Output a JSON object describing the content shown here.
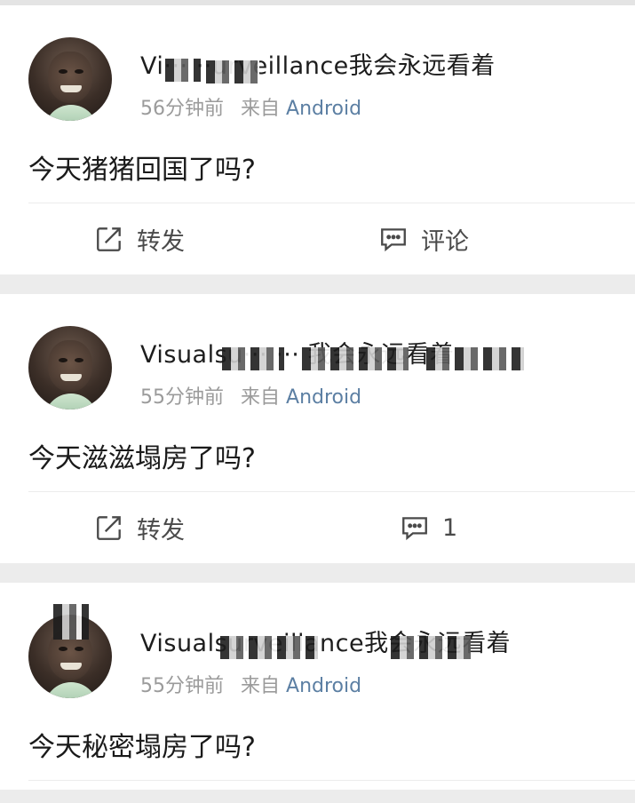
{
  "posts": [
    {
      "username": "Vi··· ··urveillance我会永远看着",
      "time": "56分钟前",
      "from": "来自",
      "source": "Android",
      "text": "今天猪猪回国了吗?",
      "forward_label": "转发",
      "comment_label": "评论"
    },
    {
      "username": "Visualsu··· ··· 我会永远看着",
      "time": "55分钟前",
      "from": "来自",
      "source": "Android",
      "text": "今天滋滋塌房了吗?",
      "forward_label": "转发",
      "comment_label": "1"
    },
    {
      "username": "Visualsurveillance我会永远看着",
      "time": "55分钟前",
      "from": "来自",
      "source": "Android",
      "text": "今天秘密塌房了吗?"
    }
  ],
  "icons": {
    "forward": "forward-icon",
    "comment": "comment-icon"
  },
  "colors": {
    "source_link": "#5c7fa3",
    "meta_gray": "#9b9b9b",
    "background": "#ececec"
  }
}
